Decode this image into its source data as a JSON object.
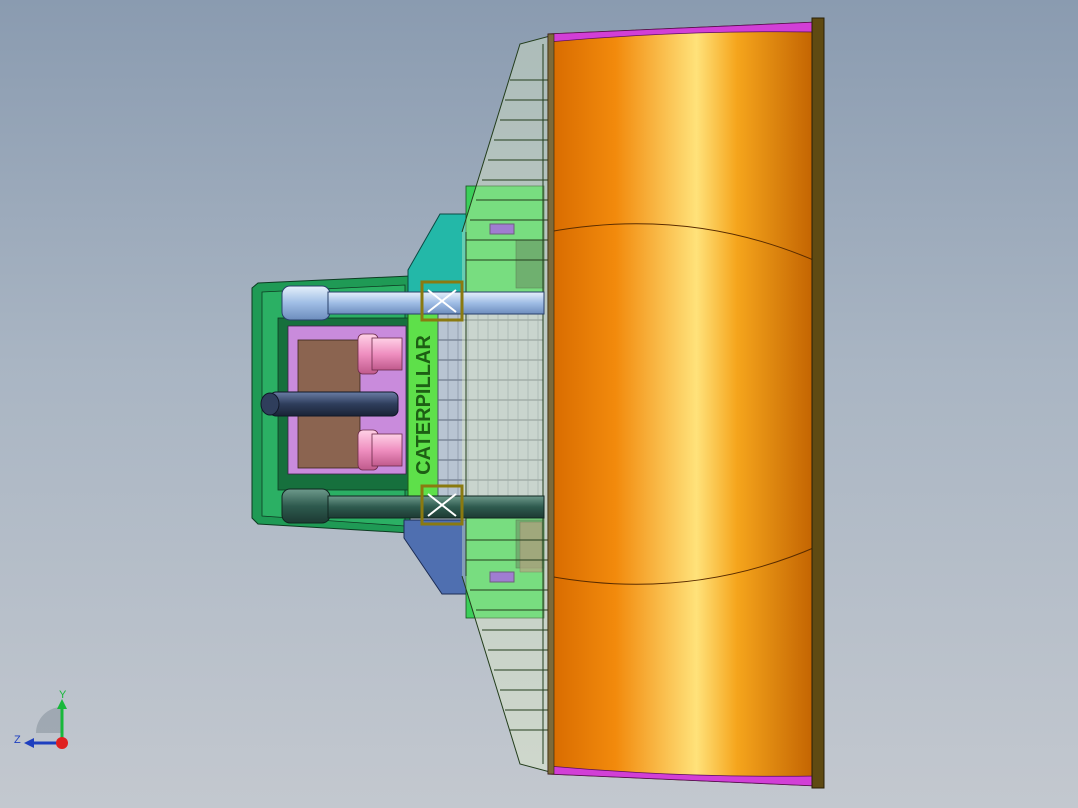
{
  "window": {
    "title": ""
  },
  "model": {
    "logo_text": "CATERPILLAR",
    "colors": {
      "blade_orange": "#f39a10",
      "blade_highlight": "#ffe07a",
      "blade_edge_magenta": "#d23fd6",
      "radiator_green": "#5ee04a",
      "frame_green": "#1f9a55",
      "teal_panel": "#23b8a8",
      "blue_panel": "#4f6fb0",
      "pink_parts": "#ef8fc0",
      "brown_block": "#8b6450",
      "lavender": "#c98bdc",
      "cyl_light": "#a9c6ea",
      "cyl_dark": "#2e5a4e",
      "rod_dark": "#2f3e5c"
    }
  },
  "triad": {
    "y_label": "Y",
    "z_label": "Z",
    "icons": {
      "axis": "triad-icon"
    }
  }
}
